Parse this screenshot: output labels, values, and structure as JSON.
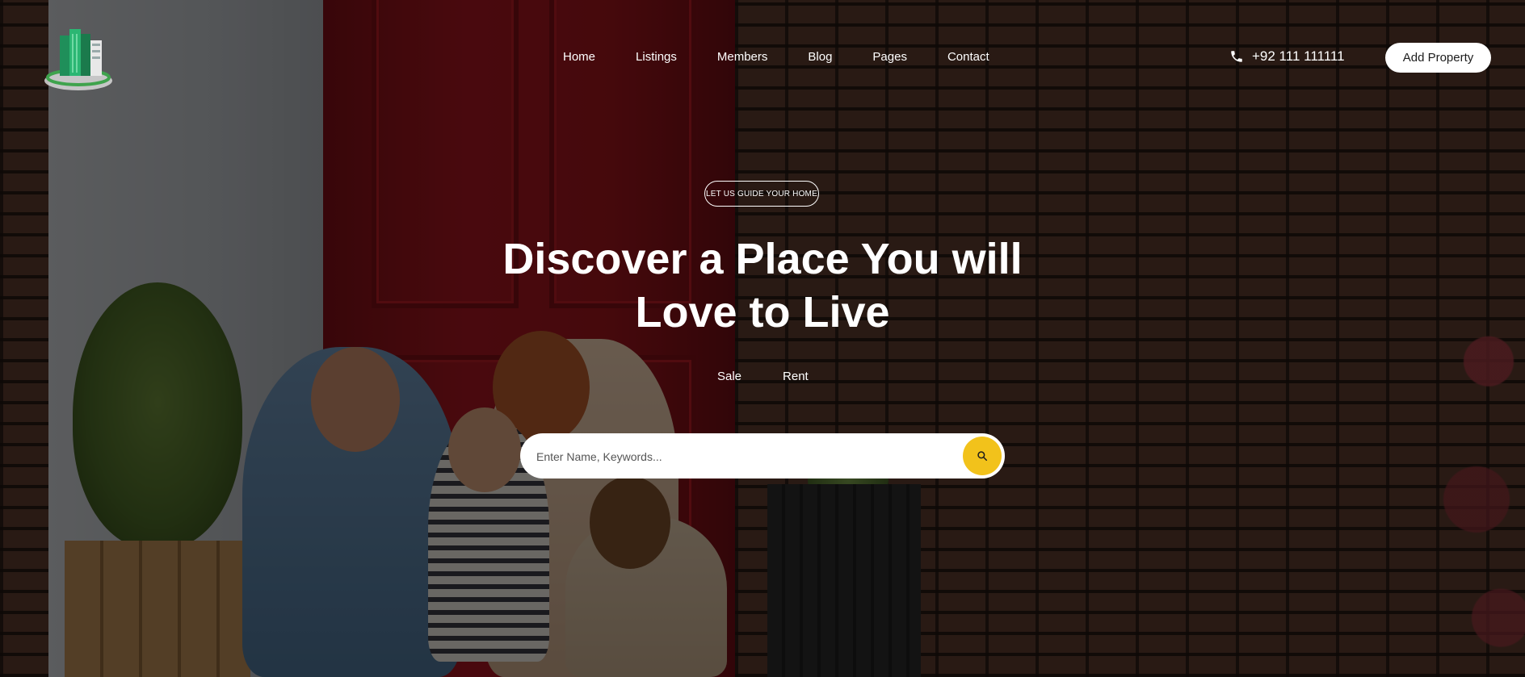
{
  "header": {
    "logo_icon": "city-buildings-logo",
    "nav": [
      {
        "label": "Home"
      },
      {
        "label": "Listings"
      },
      {
        "label": "Members"
      },
      {
        "label": "Blog"
      },
      {
        "label": "Pages"
      },
      {
        "label": "Contact"
      }
    ],
    "phone_icon": "phone-icon",
    "phone": "+92 111 111111",
    "add_property_label": "Add Property"
  },
  "hero": {
    "tagline": "LET US GUIDE YOUR HOME",
    "title_line1": "Discover a Place You will",
    "title_line2": "Love to Live",
    "tabs": [
      {
        "label": "Sale"
      },
      {
        "label": "Rent"
      }
    ],
    "search": {
      "placeholder": "Enter Name, Keywords...",
      "value": "",
      "button_icon": "search-icon"
    }
  },
  "colors": {
    "accent": "#f2c21b",
    "button_bg": "#ffffff",
    "text": "#ffffff"
  }
}
